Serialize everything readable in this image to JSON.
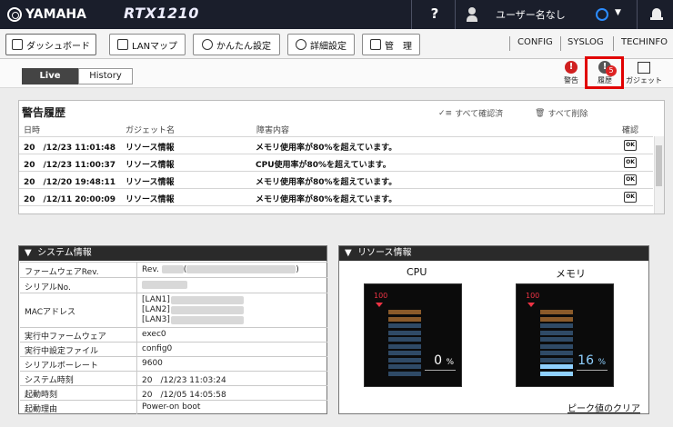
{
  "header": {
    "brand": "YAMAHA",
    "model": "RTX1210",
    "help": "?",
    "user": "ユーザー名なし"
  },
  "nav": {
    "tabs": [
      "ダッシュボード",
      "LANマップ",
      "かんたん設定",
      "詳細設定",
      "管　理"
    ],
    "links": [
      "CONFIG",
      "SYSLOG",
      "TECHINFO"
    ]
  },
  "subbar": {
    "live": "Live",
    "history": "History",
    "tools": [
      {
        "label": "警告",
        "icon": "warning-icon",
        "color": "#d02020"
      },
      {
        "label": "履歴",
        "icon": "history-icon",
        "color": "#555555",
        "badge": "5"
      },
      {
        "label": "ガジェット",
        "icon": "gadget-icon"
      }
    ],
    "highlight_color": "#e10000"
  },
  "alerts": {
    "title": "警告履歴",
    "columns": [
      "日時",
      "ガジェット名",
      "障害内容",
      "確認"
    ],
    "confirm_all": "すべて確認済",
    "delete_all": "すべて削除",
    "rows": [
      {
        "date": "20　/12/23 11:01:48",
        "gadget": "リソース情報",
        "message": "メモリ使用率が80%を超えています。",
        "ok": "OK"
      },
      {
        "date": "20　/12/23 11:00:37",
        "gadget": "リソース情報",
        "message": "CPU使用率が80%を超えています。",
        "ok": "OK"
      },
      {
        "date": "20　/12/20 19:48:11",
        "gadget": "リソース情報",
        "message": "メモリ使用率が80%を超えています。",
        "ok": "OK"
      },
      {
        "date": "20　/12/11 20:00:09",
        "gadget": "リソース情報",
        "message": "メモリ使用率が80%を超えています。",
        "ok": "OK"
      }
    ]
  },
  "system": {
    "title": "システム情報",
    "rows": [
      {
        "label": "ファームウェアRev.",
        "value": "Rev."
      },
      {
        "label": "シリアルNo.",
        "value": ""
      },
      {
        "label": "MACアドレス",
        "value": "[LAN1]\n[LAN2]\n[LAN3]"
      },
      {
        "label": "実行中ファームウェア",
        "value": "exec0"
      },
      {
        "label": "実行中設定ファイル",
        "value": "config0"
      },
      {
        "label": "シリアルボーレート",
        "value": "9600"
      },
      {
        "label": "システム時刻",
        "value": "20　/12/23 11:03:24"
      },
      {
        "label": "起動時刻",
        "value": "20　/12/05 14:05:58"
      },
      {
        "label": "起動理由",
        "value": "Power-on boot"
      }
    ]
  },
  "resource": {
    "title": "リソース情報",
    "cpu": {
      "label": "CPU",
      "max": "100",
      "value": 0,
      "unit": "%"
    },
    "memory": {
      "label": "メモリ",
      "max": "100",
      "value": 16,
      "unit": "%"
    },
    "peak_clear": "ピーク値のクリア"
  }
}
